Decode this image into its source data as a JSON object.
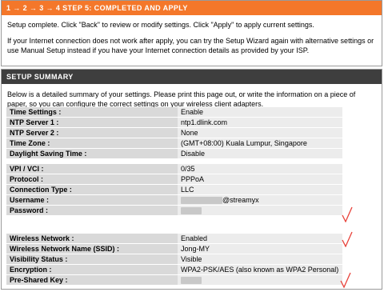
{
  "step": {
    "title": "1 → 2 → 3 → 4 STEP 5: COMPLETED AND APPLY",
    "text1": "Setup complete. Click \"Back\" to review or modify settings. Click \"Apply\" to apply current settings.",
    "text2": "If your Internet connection does not work after apply, you can try the Setup Wizard again with alternative settings or use Manual Setup instead if you have your Internet connection details as provided by your ISP."
  },
  "summary": {
    "title": "SETUP SUMMARY",
    "intro": "Below is a detailed summary of your settings. Please print this page out, or write the information on a piece of paper, so you can configure the correct settings on your wireless client adapters.",
    "groups": [
      {
        "rows": [
          {
            "label": "Time Settings :",
            "value": "Enable"
          },
          {
            "label": "NTP Server 1 :",
            "value": "ntp1.dlink.com"
          },
          {
            "label": "NTP Server 2 :",
            "value": "None"
          },
          {
            "label": "Time Zone :",
            "value": "(GMT+08:00) Kuala Lumpur, Singapore"
          },
          {
            "label": "Daylight Saving Time :",
            "value": "Disable"
          }
        ]
      },
      {
        "rows": [
          {
            "label": "VPI / VCI :",
            "value": "0/35"
          },
          {
            "label": "Protocol :",
            "value": "PPPoA"
          },
          {
            "label": "Connection Type :",
            "value": "LLC"
          },
          {
            "label": "Username :",
            "value": "@streamyx"
          },
          {
            "label": "Password :",
            "value": ""
          }
        ]
      },
      {
        "rows": [
          {
            "label": "Wireless Network :",
            "value": "Enabled"
          },
          {
            "label": "Wireless Network Name (SSID) :",
            "value": "Jong-MY"
          },
          {
            "label": "Visibility Status :",
            "value": "Visible"
          },
          {
            "label": "Encryption :",
            "value": "WPA2-PSK/AES (also known as WPA2 Personal)"
          },
          {
            "label": "Pre-Shared Key :",
            "value": ""
          }
        ]
      }
    ]
  },
  "annotations": {
    "check_glyph": "√",
    "check_color": "#e8423a"
  },
  "colors": {
    "orange_header": "#f4772a",
    "dark_header": "#3e3e3e"
  }
}
